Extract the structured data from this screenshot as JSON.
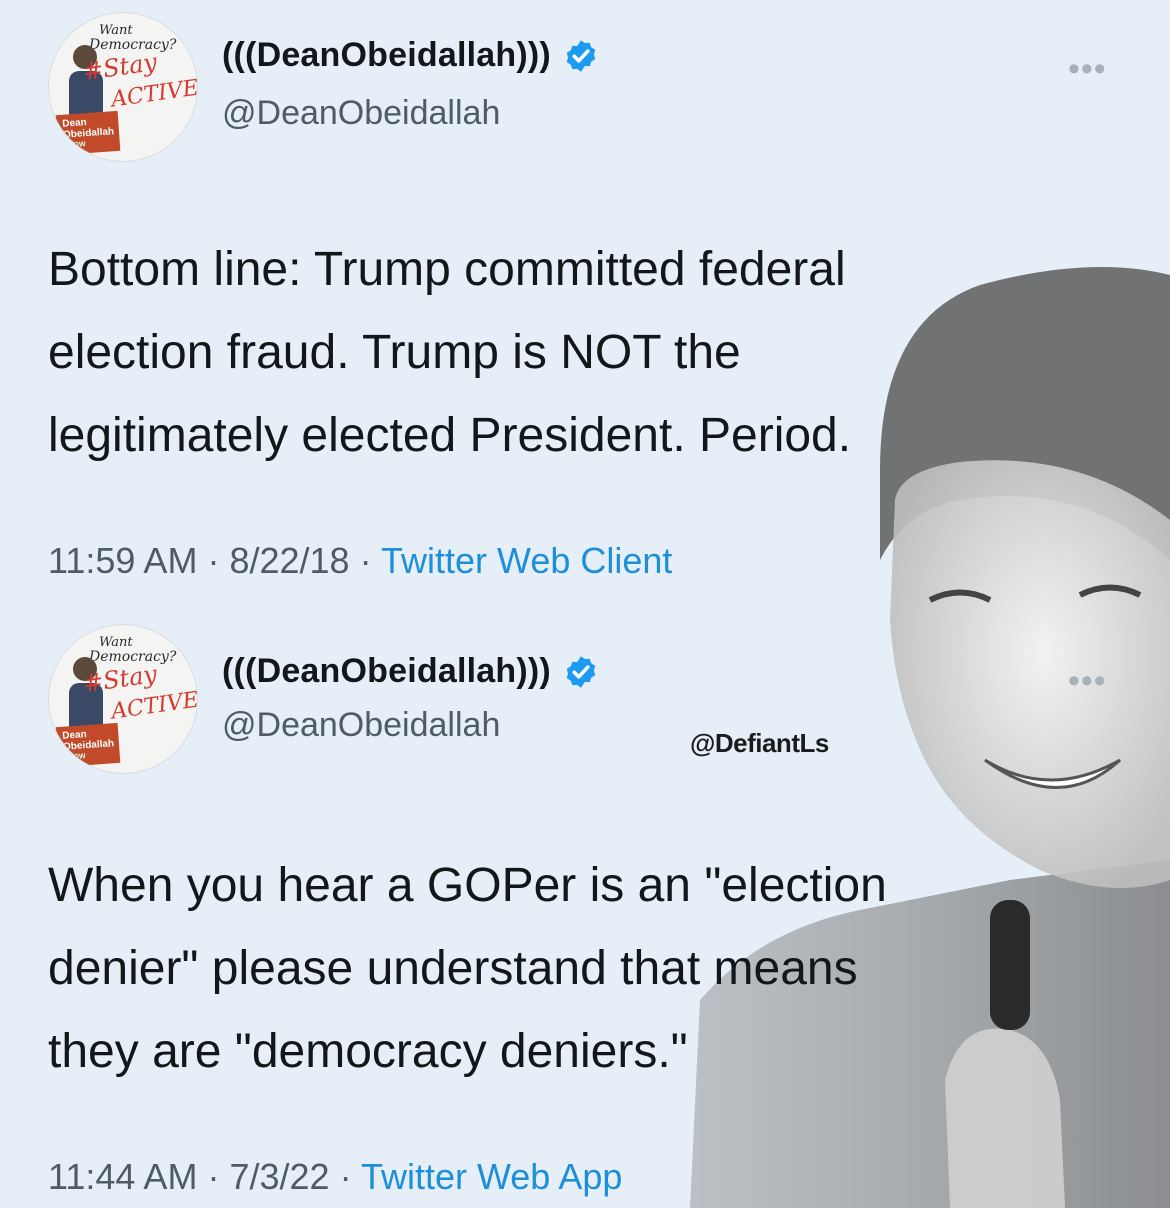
{
  "tweets": [
    {
      "display_name": "(((DeanObeidallah)))",
      "handle": "@DeanObeidallah",
      "avatar": {
        "want": "Want",
        "democracy": "Democracy?",
        "stay": "#Stay",
        "active": "ACTIVE!",
        "show_name": "Dean Obeidallah",
        "show_tag": "SHOW"
      },
      "text_lines": [
        "Bottom line: Trump committed federal",
        "election fraud. Trump is NOT the",
        "legitimately elected President. Period."
      ],
      "time": "11:59 AM",
      "date": "8/22/18",
      "source": "Twitter Web Client"
    },
    {
      "display_name": "(((DeanObeidallah)))",
      "handle": "@DeanObeidallah",
      "avatar": {
        "want": "Want",
        "democracy": "Democracy?",
        "stay": "#Stay",
        "active": "ACTIVE!",
        "show_name": "Dean Obeidallah",
        "show_tag": "SHOW"
      },
      "text_lines": [
        "When you hear a GOPer is an \"election",
        "denier\" please understand that means",
        "they are \"democracy deniers.\""
      ],
      "time": "11:44 AM",
      "date": "7/3/22",
      "source": "Twitter Web App"
    }
  ],
  "separator": "·",
  "more_glyph": "•••",
  "watermark": "@DefiantLs",
  "icons": {
    "verified": "verified-badge-icon",
    "more": "more-options-icon"
  },
  "colors": {
    "background": "#e6eff8",
    "link": "#1d8fd8",
    "verified": "#1d9bf0",
    "avatar_accent": "#d43a2f"
  }
}
